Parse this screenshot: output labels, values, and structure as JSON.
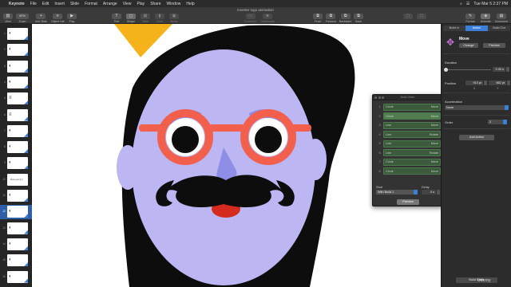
{
  "menubar": {
    "apple_icon": "",
    "app_name": "Keynote",
    "items": [
      "File",
      "Edit",
      "Insert",
      "Slide",
      "Format",
      "Arrange",
      "View",
      "Play",
      "Share",
      "Window",
      "Help"
    ],
    "clock": "Tue Mar 5  2:37 PM"
  },
  "window": {
    "title": "Inverter logo animation"
  },
  "toolbar": {
    "view": {
      "label": "View",
      "icon": "sidebar-icon"
    },
    "zoom": {
      "label": "Zoom",
      "value": "60%"
    },
    "add_slide": {
      "label": "Add Slide",
      "icon": "plus-icon"
    },
    "object_list": {
      "label": "Object List",
      "icon": "list-icon"
    },
    "play": {
      "label": "Play",
      "icon": "play-icon"
    },
    "text": {
      "label": "Text",
      "icon": "text-box-icon"
    },
    "shape": {
      "label": "Shape",
      "icon": "shape-icon"
    },
    "table": {
      "label": "Table",
      "icon": "table-icon"
    },
    "chart": {
      "label": "Chart",
      "icon": "chart-icon"
    },
    "media": {
      "label": "Media",
      "icon": "media-icon"
    },
    "comment": {
      "label": "Comment",
      "icon": "comment-icon"
    },
    "collaborate": {
      "label": "Collaborate",
      "icon": "collaborate-icon"
    },
    "front": {
      "label": "Front",
      "icon": "front-icon"
    },
    "forward": {
      "label": "Forward",
      "icon": "forward-icon"
    },
    "backward": {
      "label": "Backward",
      "icon": "backward-icon"
    },
    "back": {
      "label": "Back",
      "icon": "back-icon"
    },
    "format": {
      "label": "Format",
      "icon": "paintbrush-icon"
    },
    "animate": {
      "label": "Animate",
      "icon": "animate-icon"
    },
    "document": {
      "label": "Document",
      "icon": "document-icon"
    }
  },
  "navigator": {
    "slides": [
      {
        "num": "1",
        "kind": "logo"
      },
      {
        "num": "2",
        "kind": "logo"
      },
      {
        "num": "3",
        "kind": "logo"
      },
      {
        "num": "4",
        "kind": "logo"
      },
      {
        "num": "5",
        "kind": "text"
      },
      {
        "num": "6",
        "kind": "text"
      },
      {
        "num": "7",
        "kind": "logo"
      },
      {
        "num": "8",
        "kind": "logo"
      },
      {
        "num": "9",
        "kind": "logo"
      },
      {
        "num": "10",
        "kind": "phrase",
        "text": "Now you try!"
      },
      {
        "num": "11",
        "kind": "logo"
      },
      {
        "num": "12",
        "kind": "logo",
        "selected": true
      },
      {
        "num": "13",
        "kind": "logo"
      },
      {
        "num": "14",
        "kind": "logo"
      },
      {
        "num": "15",
        "kind": "logo"
      },
      {
        "num": "16",
        "kind": "logo"
      }
    ]
  },
  "canvas": {
    "colors": {
      "hair": "#0d0d0d",
      "face": "#bcb6f2",
      "hat": "#f5b21b",
      "glasses": "#f25f4c",
      "nose": "#8e8ee6",
      "mustache": "#0d0d0d",
      "tongue": "#d52b1e",
      "eye_white": "#ffffff",
      "pupil": "#0d0d0d",
      "brow": "#8a8ee8"
    }
  },
  "build_order": {
    "title": "Build Order",
    "rows": [
      {
        "num": "1",
        "object": "Circle",
        "effect": "Move"
      },
      {
        "num": "2",
        "object": "Circle",
        "effect": "Move",
        "selected": true
      },
      {
        "num": "3",
        "object": "Line",
        "effect": "Move"
      },
      {
        "num": "4",
        "object": "Line",
        "effect": "Rotate"
      },
      {
        "num": "5",
        "object": "Line",
        "effect": "Move"
      },
      {
        "num": "6",
        "object": "Line",
        "effect": "Rotate"
      },
      {
        "num": "7",
        "object": "Circle",
        "effect": "Move"
      },
      {
        "num": "8",
        "object": "Circle",
        "effect": "Move"
      }
    ],
    "start_label": "Start",
    "start_value": "With Build 1",
    "delay_label": "Delay",
    "delay_value": "0 s",
    "preview_label": "Preview"
  },
  "inspector": {
    "tabs": [
      "Build In",
      "Action",
      "Build Out"
    ],
    "active_tab": "Action",
    "effect_name": "Move",
    "change_label": "Change",
    "preview_label": "Preview",
    "duration_label": "Duration",
    "duration_value": "0.00 s",
    "duration_fraction": 0.03,
    "position_label": "Position",
    "position_x": "913 pt",
    "position_y": "562 pt",
    "x_caption": "X",
    "y_caption": "Y",
    "acceleration_label": "Acceleration",
    "acceleration_value": "None",
    "order_label": "Order",
    "order_value": "2",
    "add_action_label": "Add Action",
    "build_order_label": "Build Order"
  },
  "watermark": "Udemy"
}
